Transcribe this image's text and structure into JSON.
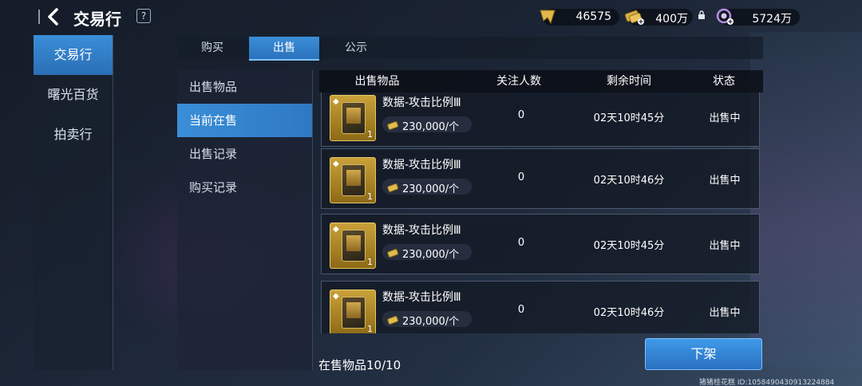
{
  "header": {
    "title": "交易行",
    "help": "?",
    "currencies": [
      {
        "icon": "badge-currency-icon",
        "value": "46575"
      },
      {
        "icon": "gold-coin-icon",
        "value": "400万"
      },
      {
        "icon": "purple-crystal-icon",
        "value": "5724万"
      }
    ]
  },
  "leftnav": [
    "交易行",
    "曙光百货",
    "拍卖行"
  ],
  "tabs": [
    "购买",
    "出售",
    "公示"
  ],
  "subnav": [
    "出售物品",
    "当前在售",
    "出售记录",
    "购买记录"
  ],
  "table": {
    "headers": [
      "出售物品",
      "关注人数",
      "剩余时间",
      "状态"
    ],
    "rows": [
      {
        "name": "数据-攻击比例Ⅲ",
        "price": "230,000/个",
        "qty": "1",
        "watchers": "0",
        "time": "02天10时45分",
        "status": "出售中"
      },
      {
        "name": "数据-攻击比例Ⅲ",
        "price": "230,000/个",
        "qty": "1",
        "watchers": "0",
        "time": "02天10时46分",
        "status": "出售中"
      },
      {
        "name": "数据-攻击比例Ⅲ",
        "price": "230,000/个",
        "qty": "1",
        "watchers": "0",
        "time": "02天10时45分",
        "status": "出售中"
      },
      {
        "name": "数据-攻击比例Ⅲ",
        "price": "230,000/个",
        "qty": "1",
        "watchers": "0",
        "time": "02天10时46分",
        "status": "出售中"
      }
    ]
  },
  "footer": {
    "count": "在售物品10/10",
    "delist_label": "下架",
    "watermark": "猪猪桂花糕  ID:1058490430913224884"
  },
  "colors": {
    "accent": "#3a8ed8",
    "gold": "#c9a23a"
  }
}
